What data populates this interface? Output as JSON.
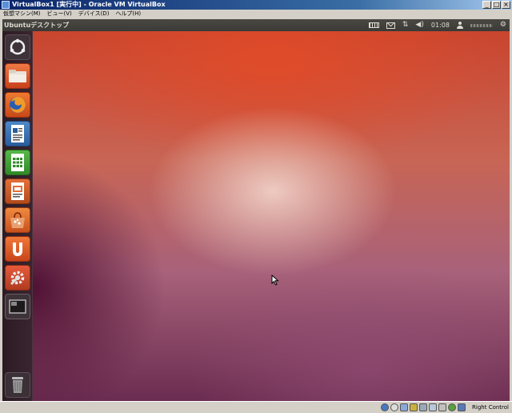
{
  "window": {
    "title": "VirtualBox1 [実行中] - Oracle VM VirtualBox",
    "minimize_glyph": "_",
    "maximize_glyph": "□",
    "close_glyph": "×"
  },
  "menu": [
    {
      "label": "仮想マシン(M)"
    },
    {
      "label": "ビュー(V)"
    },
    {
      "label": "デバイス(D)"
    },
    {
      "label": "ヘルプ(H)"
    }
  ],
  "panel": {
    "title": "Ubuntuデスクトップ",
    "clock": "01:08",
    "indicators": [
      "keyboard-icon",
      "mail-icon",
      "network-icon",
      "volume-icon",
      "user-icon",
      "gear-icon"
    ]
  },
  "launcher": {
    "items": [
      "dash-home-icon",
      "files-folder-icon",
      "firefox-icon",
      "writer-icon",
      "calc-icon",
      "impress-icon",
      "software-center-icon",
      "ubuntu-one-icon",
      "system-settings-icon",
      "workspaces-icon"
    ],
    "trash": "trash-icon"
  },
  "statusbar": {
    "host_key": "Right Control",
    "icons": [
      "harddisk-icon",
      "optical-drive-icon",
      "usb-icon",
      "shared-folders-icon",
      "display-icon",
      "network-adapter-icon",
      "capture-icon",
      "mouse-integration-icon",
      "keyboard-capture-icon"
    ]
  },
  "colors": {
    "launcher_bg": "#2c1b23",
    "panel_bg": "#3b3a36",
    "wallpaper_top": "#c9452e",
    "wallpaper_bottom": "#6a2c50"
  }
}
